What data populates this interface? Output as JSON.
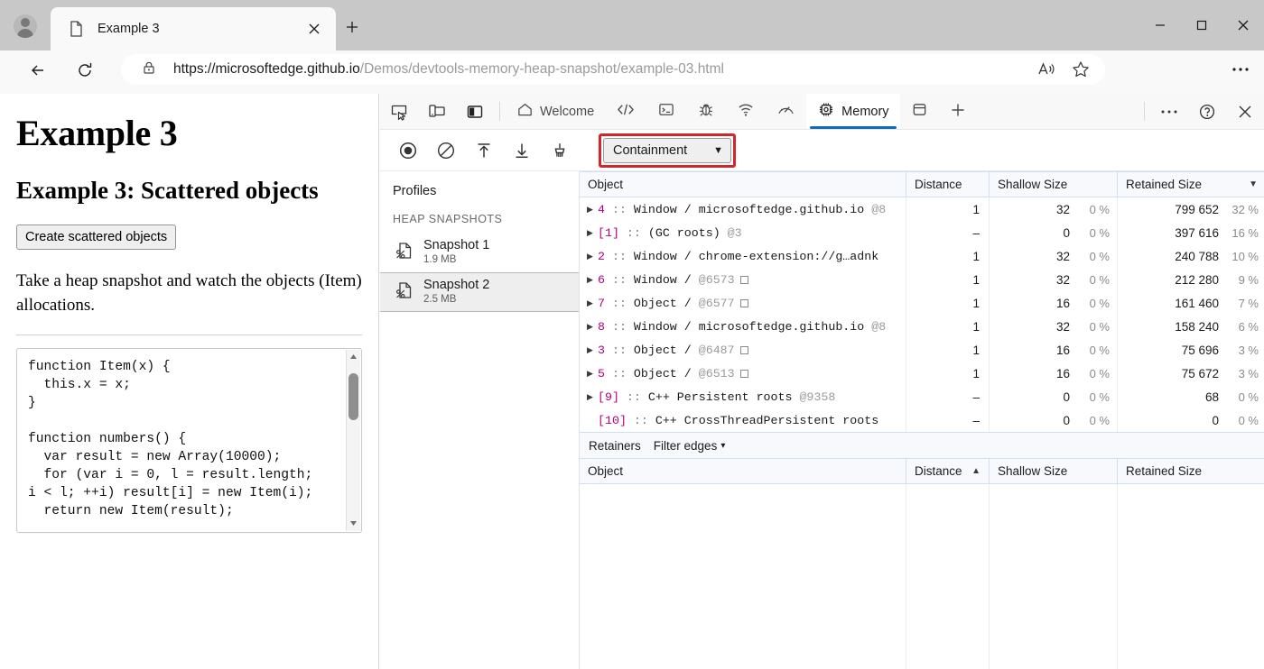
{
  "browser": {
    "window_controls": {
      "minimize": "minimize-icon",
      "maximize": "maximize-icon",
      "close": "close-icon"
    },
    "tab": {
      "title": "Example 3",
      "favicon": "page-icon",
      "close_label": "×"
    },
    "new_tab_label": "+",
    "nav": {
      "back": "back-arrow-icon",
      "reload": "reload-icon"
    },
    "omnibox": {
      "lock": "lock-icon",
      "url_host": "https://microsoftedge.github.io",
      "url_path": "/Demos/devtools-memory-heap-snapshot/example-03.html",
      "url_full": "https://microsoftedge.github.io/Demos/devtools-memory-heap-snapshot/example-03.html",
      "read_aloud": "read-aloud-icon",
      "favorite": "star-icon"
    },
    "settings_label": "…"
  },
  "page": {
    "h1": "Example 3",
    "h2": "Example 3: Scattered objects",
    "button": "Create scattered objects",
    "paragraph": "Take a heap snapshot and watch the objects (Item) allocations.",
    "code": "function Item(x) {\n  this.x = x;\n}\n\nfunction numbers() {\n  var result = new Array(10000);\n  for (var i = 0, l = result.length;\ni < l; ++i) result[i] = new Item(i);\n  return new Item(result);"
  },
  "devtools": {
    "left_icons": [
      {
        "name": "inspect-element-icon"
      },
      {
        "name": "device-emulation-icon"
      },
      {
        "name": "dock-side-icon"
      }
    ],
    "tabs": [
      {
        "label": "Welcome",
        "icon": "home-icon",
        "active": false
      },
      {
        "label": "",
        "icon": "elements-icon",
        "active": false
      },
      {
        "label": "",
        "icon": "console-icon",
        "active": false
      },
      {
        "label": "",
        "icon": "debugger-icon",
        "active": false
      },
      {
        "label": "",
        "icon": "network-icon",
        "active": false
      },
      {
        "label": "",
        "icon": "performance-icon",
        "active": false
      },
      {
        "label": "Memory",
        "icon": "memory-chip-icon",
        "active": true
      },
      {
        "label": "",
        "icon": "application-icon",
        "active": false
      },
      {
        "label": "+",
        "icon": "more-tools-icon",
        "active": false
      }
    ],
    "right_actions": [
      {
        "name": "more-options-icon",
        "glyph": "•••"
      },
      {
        "name": "help-icon",
        "glyph": "?"
      },
      {
        "name": "close-devtools-icon",
        "glyph": "✕"
      }
    ],
    "toolbar": {
      "icons": [
        {
          "name": "record-icon"
        },
        {
          "name": "clear-icon"
        },
        {
          "name": "load-profile-icon"
        },
        {
          "name": "save-profile-icon"
        },
        {
          "name": "collect-garbage-icon"
        }
      ],
      "view_select": {
        "value": "Containment",
        "caret": "▼",
        "highlight_color": "#d1272b"
      }
    },
    "sidebar": {
      "title": "Profiles",
      "section": "Heap snapshots",
      "snapshots": [
        {
          "name": "Snapshot 1",
          "size": "1.9 MB",
          "icon": "heap-snapshot-icon",
          "selected": false
        },
        {
          "name": "Snapshot 2",
          "size": "2.5 MB",
          "icon": "heap-snapshot-icon",
          "selected": true
        }
      ]
    },
    "grid": {
      "columns": [
        {
          "key": "object",
          "label": "Object"
        },
        {
          "key": "distance",
          "label": "Distance"
        },
        {
          "key": "shallow",
          "label": "Shallow Size"
        },
        {
          "key": "retained",
          "label": "Retained Size",
          "sorted": "desc",
          "sort_glyph": "▼"
        }
      ],
      "rows": [
        {
          "expandable": true,
          "index": "4",
          "bracketed": false,
          "title": "Window / microsoftedge.github.io",
          "at": "@8",
          "truncated": true,
          "box": false,
          "distance": "1",
          "shallow": "32",
          "shallow_pct": "0 %",
          "retained": "799 652",
          "retained_pct": "32 %"
        },
        {
          "expandable": true,
          "index": "[1]",
          "bracketed": true,
          "title": "(GC roots)",
          "at": "@3",
          "truncated": false,
          "box": false,
          "distance": "–",
          "shallow": "0",
          "shallow_pct": "0 %",
          "retained": "397 616",
          "retained_pct": "16 %"
        },
        {
          "expandable": true,
          "index": "2",
          "bracketed": false,
          "title": "Window / chrome-extension://g…adnk",
          "at": "",
          "truncated": true,
          "box": false,
          "distance": "1",
          "shallow": "32",
          "shallow_pct": "0 %",
          "retained": "240 788",
          "retained_pct": "10 %"
        },
        {
          "expandable": true,
          "index": "6",
          "bracketed": false,
          "title": "Window /",
          "at": "@6573",
          "truncated": false,
          "box": true,
          "distance": "1",
          "shallow": "32",
          "shallow_pct": "0 %",
          "retained": "212 280",
          "retained_pct": "9 %"
        },
        {
          "expandable": true,
          "index": "7",
          "bracketed": false,
          "title": "Object /",
          "at": "@6577",
          "truncated": false,
          "box": true,
          "distance": "1",
          "shallow": "16",
          "shallow_pct": "0 %",
          "retained": "161 460",
          "retained_pct": "7 %"
        },
        {
          "expandable": true,
          "index": "8",
          "bracketed": false,
          "title": "Window / microsoftedge.github.io",
          "at": "@8",
          "truncated": true,
          "box": false,
          "distance": "1",
          "shallow": "32",
          "shallow_pct": "0 %",
          "retained": "158 240",
          "retained_pct": "6 %"
        },
        {
          "expandable": true,
          "index": "3",
          "bracketed": false,
          "title": "Object /",
          "at": "@6487",
          "truncated": false,
          "box": true,
          "distance": "1",
          "shallow": "16",
          "shallow_pct": "0 %",
          "retained": "75 696",
          "retained_pct": "3 %"
        },
        {
          "expandable": true,
          "index": "5",
          "bracketed": false,
          "title": "Object /",
          "at": "@6513",
          "truncated": false,
          "box": true,
          "distance": "1",
          "shallow": "16",
          "shallow_pct": "0 %",
          "retained": "75 672",
          "retained_pct": "3 %"
        },
        {
          "expandable": true,
          "index": "[9]",
          "bracketed": true,
          "title": "C++ Persistent roots",
          "at": "@9358",
          "truncated": false,
          "box": false,
          "distance": "–",
          "shallow": "0",
          "shallow_pct": "0 %",
          "retained": "68",
          "retained_pct": "0 %"
        },
        {
          "expandable": false,
          "index": "[10]",
          "bracketed": true,
          "title": "C++ CrossThreadPersistent roots",
          "at": "",
          "truncated": true,
          "box": false,
          "distance": "–",
          "shallow": "0",
          "shallow_pct": "0 %",
          "retained": "0",
          "retained_pct": "0 %"
        }
      ]
    },
    "retainers": {
      "label": "Retainers",
      "filter_label": "Filter edges",
      "filter_caret": "▾",
      "columns": [
        {
          "key": "object",
          "label": "Object"
        },
        {
          "key": "distance",
          "label": "Distance",
          "sorted": "asc",
          "sort_glyph": "▲"
        },
        {
          "key": "shallow",
          "label": "Shallow Size"
        },
        {
          "key": "retained",
          "label": "Retained Size"
        }
      ],
      "rows": []
    }
  }
}
